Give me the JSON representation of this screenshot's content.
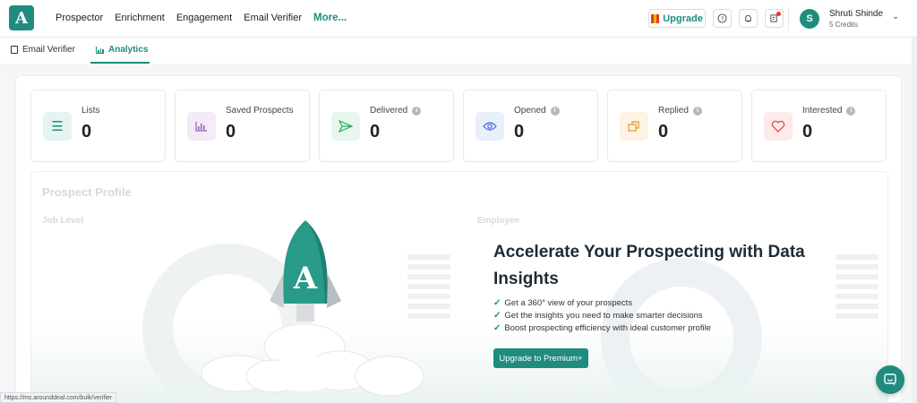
{
  "app": {
    "logo_letter": "A"
  },
  "nav": {
    "items": [
      "Prospector",
      "Enrichment",
      "Engagement",
      "Email Verifier"
    ],
    "more": "More..."
  },
  "topbar": {
    "upgrade_label": "Upgrade",
    "help_icon": "question-icon",
    "bell_icon": "bell-icon",
    "tasks_icon": "tasks-icon"
  },
  "user": {
    "initial": "S",
    "name": "Shruti Shinde",
    "credits": "5 Credits"
  },
  "tabs": [
    {
      "label": "Email Verifier",
      "active": false
    },
    {
      "label": "Analytics",
      "active": true
    }
  ],
  "stats": [
    {
      "label": "Lists",
      "value": "0",
      "icon": "list-icon",
      "info": false,
      "color": "#1f8c7d",
      "bg": "#e6f4f1"
    },
    {
      "label": "Saved Prospects",
      "value": "0",
      "icon": "bar-chart-icon",
      "info": false,
      "color": "#9b59b6",
      "bg": "#f3ebf8"
    },
    {
      "label": "Delivered",
      "value": "0",
      "icon": "send-icon",
      "info": true,
      "color": "#27ae60",
      "bg": "#e8f6ee"
    },
    {
      "label": "Opened",
      "value": "0",
      "icon": "eye-icon",
      "info": true,
      "color": "#3b6fd9",
      "bg": "#e9effb"
    },
    {
      "label": "Replied",
      "value": "0",
      "icon": "reply-icon",
      "info": true,
      "color": "#e6962b",
      "bg": "#fdf2e4"
    },
    {
      "label": "Interested",
      "value": "0",
      "icon": "heart-icon",
      "info": true,
      "color": "#e2474b",
      "bg": "#fdeaea"
    }
  ],
  "profile": {
    "title": "Prospect Profile",
    "job_level": "Job Level",
    "employee": "Employee"
  },
  "cta": {
    "title": "Accelerate Your Prospecting with Data Insights",
    "points": [
      "Get a 360° view of your prospects",
      "Get the insights you need to make smarter decisions",
      "Boost prospecting efficiency with ideal customer profile"
    ],
    "button": "Upgrade to Premium+"
  },
  "status_url": "https://ms.arounddeal.com/bulk/verifier"
}
